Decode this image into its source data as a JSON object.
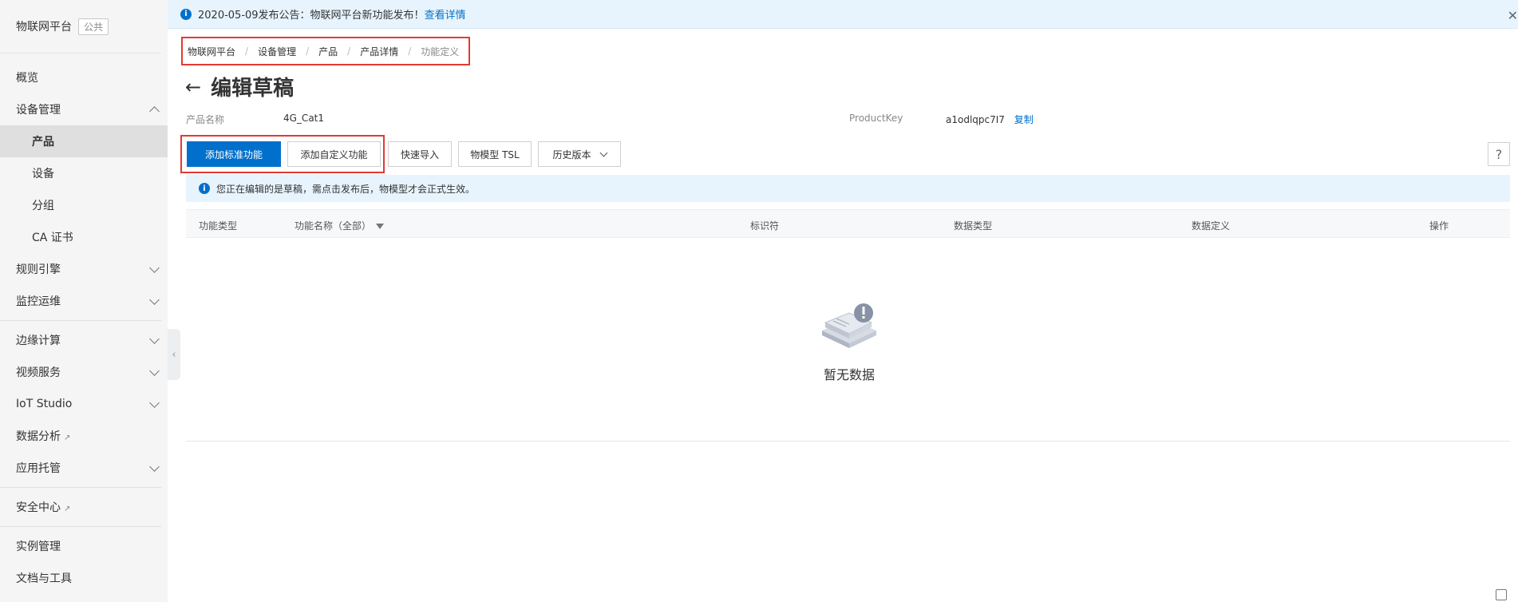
{
  "sidebar": {
    "title": "物联网平台",
    "badge": "公共",
    "items": [
      {
        "label": "概览"
      },
      {
        "label": "设备管理"
      },
      {
        "label": "产品"
      },
      {
        "label": "设备"
      },
      {
        "label": "分组"
      },
      {
        "label": "CA 证书"
      },
      {
        "label": "规则引擎"
      },
      {
        "label": "监控运维"
      },
      {
        "label": "边缘计算"
      },
      {
        "label": "视频服务"
      },
      {
        "label": "IoT Studio"
      },
      {
        "label": "数据分析"
      },
      {
        "label": "应用托管"
      },
      {
        "label": "安全中心"
      },
      {
        "label": "实例管理"
      },
      {
        "label": "文档与工具"
      }
    ]
  },
  "notice": {
    "text": "2020-05-09发布公告：物联网平台新功能发布！",
    "link": "查看详情",
    "close": "✕"
  },
  "breadcrumb": [
    "物联网平台",
    "设备管理",
    "产品",
    "产品详情",
    "功能定义"
  ],
  "page": {
    "back": "←",
    "title": "编辑草稿",
    "product_name_label": "产品名称",
    "product_name_value": "4G_Cat1",
    "product_key_label": "ProductKey",
    "product_key_value": "a1odlqpc7I7",
    "copy_label": "复制"
  },
  "toolbar": {
    "add_standard": "添加标准功能",
    "add_custom": "添加自定义功能",
    "quick_import": "快速导入",
    "tsl": "物模型 TSL",
    "history": "历史版本",
    "help": "?"
  },
  "tip": {
    "icon": "i",
    "text": "您正在编辑的是草稿，需点击发布后，物模型才会正式生效。"
  },
  "table": {
    "columns": [
      "功能类型",
      "功能名称（全部）",
      "标识符",
      "数据类型",
      "数据定义",
      "操作"
    ],
    "empty_text": "暂无数据"
  },
  "colors": {
    "accent": "#0070cc",
    "highlight": "#e53935",
    "notice_bg": "#e8f4fd"
  }
}
